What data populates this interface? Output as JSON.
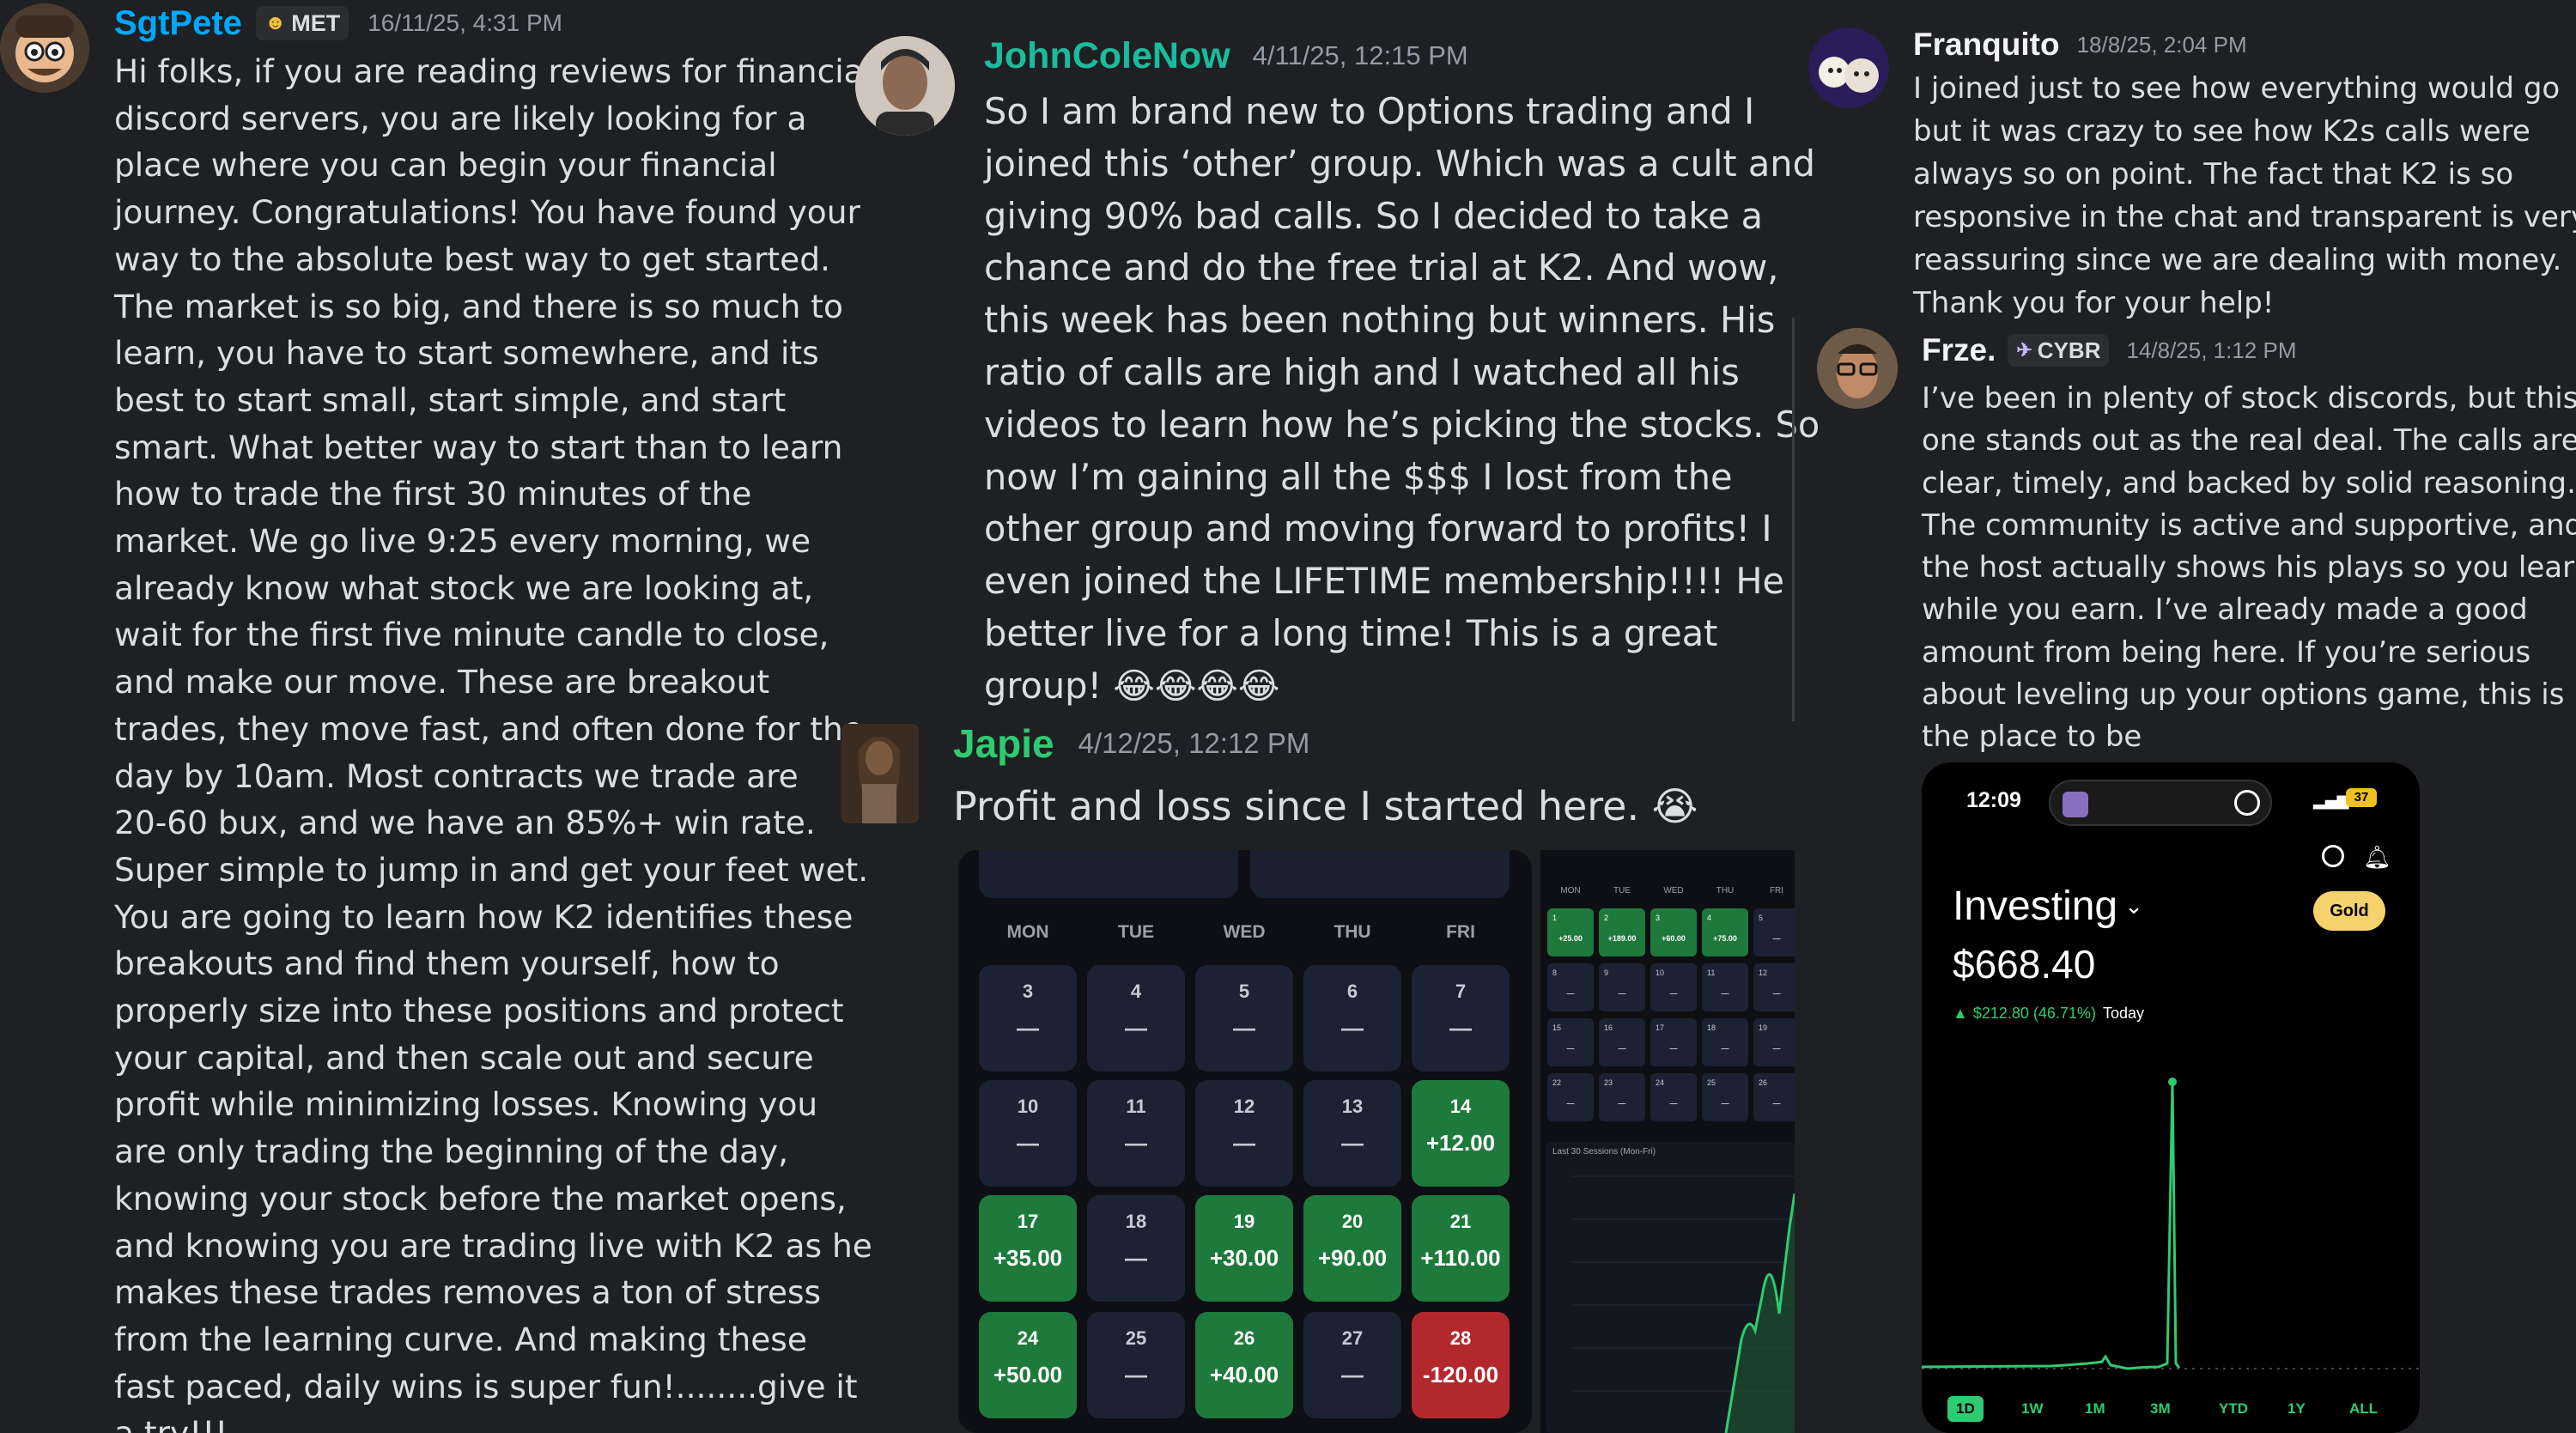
{
  "messages": {
    "sgtpete": {
      "username": "SgtPete",
      "tag": "MET",
      "timestamp": "16/11/25, 4:31 PM",
      "lines": [
        "Hi folks, if you are reading reviews for financial",
        "discord servers, you are likely looking for a",
        "place where you can begin your financial",
        "journey.  Congratulations! You have found your",
        "way to the absolute best way to get started.",
        "The market is so big, and there is so much to",
        "learn, you have to start somewhere, and its",
        "best to start small, start simple, and start",
        "smart. What better way to start than to learn",
        "how to trade the first 30 minutes of the",
        "market.  We go live 9:25 every morning, we",
        "already know what stock we are looking at,",
        "wait for the first five minute candle to close,",
        "and make our move. These are breakout",
        "trades, they move fast, and often done for the",
        "day by 10am.  Most contracts we trade are",
        "20-60 bux, and we have an 85%+ win rate.",
        "Super simple to jump in and get your feet wet.",
        "You are going to learn how K2 identifies these",
        "breakouts and find them yourself,  how to",
        "properly size into these positions and protect",
        "your capital, and then scale out and secure",
        "profit while minimizing losses.  Knowing you",
        "are only trading the beginning of the day,",
        "knowing your stock before the market opens,",
        "and knowing you are trading live with K2 as he",
        "makes these trades removes a ton of stress",
        "from the learning curve. And making these",
        "fast paced, daily wins is super fun!........give it",
        "a try!!!"
      ]
    },
    "johncole": {
      "username": "JohnColeNow",
      "timestamp": "4/11/25, 12:15 PM",
      "lines": [
        "So I am brand new to Options trading and I",
        "joined this ‘other’ group. Which was a cult and",
        "giving 90% bad calls. So I decided to take a",
        "chance and do the free trial at K2. And wow,",
        "this week has been nothing but winners. His",
        "ratio of calls are high and I watched all his",
        "videos to learn how he’s picking the stocks. So",
        "now I’m gaining all the $$$ I lost from the",
        "other group and moving forward to profits! I",
        "even joined the LIFETIME membership!!!! He",
        "better live for a long time!  This is a great",
        "group! 😂😂😂😂"
      ]
    },
    "japie": {
      "username": "Japie",
      "timestamp": "4/12/25, 12:12 PM",
      "text": "Profit and loss since I started here. 😭"
    },
    "franquito": {
      "username": "Franquito",
      "timestamp": "18/8/25, 2:04 PM",
      "lines": [
        "I joined just to see how everything would go",
        "but it was crazy to see how K2s calls were",
        "always so on point. The fact that K2 is so",
        "responsive in the chat and transparent is very",
        "reassuring since we are dealing with money.",
        "Thank you for your help!"
      ]
    },
    "frze": {
      "username": "Frze.",
      "tag": "CYBR",
      "timestamp": "14/8/25, 1:12 PM",
      "lines": [
        "I’ve been in plenty of stock discords, but this",
        "one stands out as the real deal. The calls are",
        "clear, timely, and backed by solid reasoning.",
        "The community is active and supportive, and",
        "the host actually shows his plays so you learn",
        "while you earn. I’ve already made a good",
        "amount from being here. If you’re serious",
        "about leveling up your options game, this is",
        "the place to be"
      ]
    }
  },
  "calendar": {
    "weekdays": [
      "MON",
      "TUE",
      "WED",
      "THU",
      "FRI"
    ],
    "rows": [
      [
        {
          "d": "3",
          "v": "—",
          "s": "n"
        },
        {
          "d": "4",
          "v": "—",
          "s": "n"
        },
        {
          "d": "5",
          "v": "—",
          "s": "n"
        },
        {
          "d": "6",
          "v": "—",
          "s": "n"
        },
        {
          "d": "7",
          "v": "—",
          "s": "n"
        }
      ],
      [
        {
          "d": "10",
          "v": "—",
          "s": "n"
        },
        {
          "d": "11",
          "v": "—",
          "s": "n"
        },
        {
          "d": "12",
          "v": "—",
          "s": "n"
        },
        {
          "d": "13",
          "v": "—",
          "s": "n"
        },
        {
          "d": "14",
          "v": "+12.00",
          "s": "g"
        }
      ],
      [
        {
          "d": "17",
          "v": "+35.00",
          "s": "g"
        },
        {
          "d": "18",
          "v": "—",
          "s": "n"
        },
        {
          "d": "19",
          "v": "+30.00",
          "s": "g"
        },
        {
          "d": "20",
          "v": "+90.00",
          "s": "g"
        },
        {
          "d": "21",
          "v": "+110.00",
          "s": "g"
        }
      ],
      [
        {
          "d": "24",
          "v": "+50.00",
          "s": "g"
        },
        {
          "d": "25",
          "v": "—",
          "s": "n"
        },
        {
          "d": "26",
          "v": "+40.00",
          "s": "g"
        },
        {
          "d": "27",
          "v": "—",
          "s": "n"
        },
        {
          "d": "28",
          "v": "-120.00",
          "s": "r"
        }
      ]
    ]
  },
  "mini_calendar": {
    "weekdays": [
      "MON",
      "TUE",
      "WED",
      "THU",
      "FRI"
    ],
    "rows": [
      [
        {
          "d": "1",
          "v": "+25.00",
          "s": "g"
        },
        {
          "d": "2",
          "v": "+189.00",
          "s": "g"
        },
        {
          "d": "3",
          "v": "+60.00",
          "s": "g"
        },
        {
          "d": "4",
          "v": "+75.00",
          "s": "g"
        },
        {
          "d": "5",
          "v": "—",
          "s": "n"
        }
      ],
      [
        {
          "d": "8",
          "v": "—",
          "s": "n"
        },
        {
          "d": "9",
          "v": "—",
          "s": "n"
        },
        {
          "d": "10",
          "v": "—",
          "s": "n"
        },
        {
          "d": "11",
          "v": "—",
          "s": "n"
        },
        {
          "d": "12",
          "v": "—",
          "s": "n"
        }
      ],
      [
        {
          "d": "15",
          "v": "—",
          "s": "n"
        },
        {
          "d": "16",
          "v": "—",
          "s": "n"
        },
        {
          "d": "17",
          "v": "—",
          "s": "n"
        },
        {
          "d": "18",
          "v": "—",
          "s": "n"
        },
        {
          "d": "19",
          "v": "—",
          "s": "n"
        }
      ],
      [
        {
          "d": "22",
          "v": "—",
          "s": "n"
        },
        {
          "d": "23",
          "v": "—",
          "s": "n"
        },
        {
          "d": "24",
          "v": "—",
          "s": "n"
        },
        {
          "d": "25",
          "v": "—",
          "s": "n"
        },
        {
          "d": "26",
          "v": "—",
          "s": "n"
        }
      ]
    ],
    "chart_title": "Last 30 Sessions (Mon-Fri)"
  },
  "phone": {
    "time": "12:09",
    "battery": "37",
    "title": "Investing",
    "value": "$668.40",
    "change": "$212.80 (46.71%)",
    "change_label": "Today",
    "badge": "Gold",
    "ranges": [
      "1D",
      "1W",
      "1M",
      "3M",
      "YTD",
      "1Y",
      "ALL"
    ]
  },
  "colors": {
    "background": "#1f2023",
    "sgtpete_name": "#00a8fc",
    "johncole_name": "#1abc9c",
    "japie_name": "#2ecc71",
    "default_name": "#f2f3f5",
    "gain_green": "#1e7a3c",
    "loss_red": "#b3282d"
  }
}
